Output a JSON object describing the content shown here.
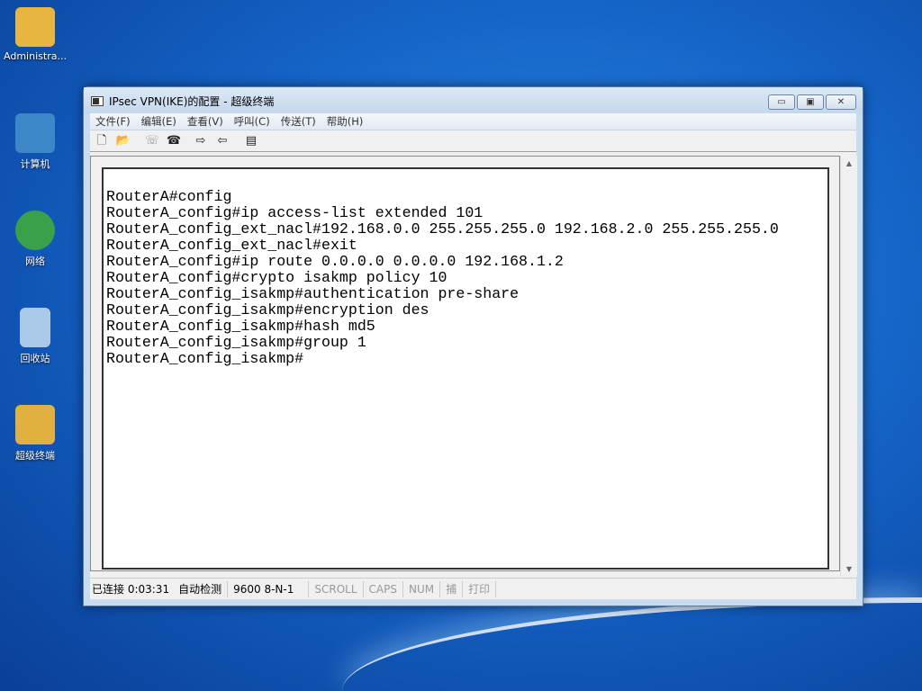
{
  "desktop": {
    "icons": [
      {
        "label": "Administra...",
        "icon": "folder-user-icon",
        "color": "#e8b640"
      },
      {
        "label": "计算机",
        "icon": "computer-icon",
        "color": "#3d86c8"
      },
      {
        "label": "网络",
        "icon": "network-icon",
        "color": "#3aa04a"
      },
      {
        "label": "回收站",
        "icon": "recycle-bin-icon",
        "color": "#aac8e8"
      },
      {
        "label": "超级终端",
        "icon": "hyperterminal-icon",
        "color": "#e0b040"
      }
    ]
  },
  "window": {
    "title": "IPsec VPN(IKE)的配置 - 超级终端",
    "minimize": "▭",
    "maximize": "▣",
    "close": "✕"
  },
  "menu": [
    "文件(F)",
    "编辑(E)",
    "查看(V)",
    "呼叫(C)",
    "传送(T)",
    "帮助(H)"
  ],
  "toolbar": [
    {
      "icon": "new-icon",
      "glyph": "🗋"
    },
    {
      "icon": "open-icon",
      "glyph": "📂"
    },
    {
      "icon": "dial-icon",
      "glyph": "☏"
    },
    {
      "icon": "disconnect-icon",
      "glyph": "☎"
    },
    {
      "icon": "send-icon",
      "glyph": "⇨"
    },
    {
      "icon": "receive-icon",
      "glyph": "⇦"
    },
    {
      "icon": "properties-icon",
      "glyph": "▤"
    }
  ],
  "terminal": {
    "lines": [
      "RouterA#config",
      "RouterA_config#ip access-list extended 101",
      "RouterA_config_ext_nacl#192.168.0.0 255.255.255.0 192.168.2.0 255.255.255.0",
      "RouterA_config_ext_nacl#exit",
      "RouterA_config#ip route 0.0.0.0 0.0.0.0 192.168.1.2",
      "RouterA_config#crypto isakmp policy 10",
      "RouterA_config_isakmp#authentication pre-share",
      "RouterA_config_isakmp#encryption des",
      "RouterA_config_isakmp#hash md5",
      "RouterA_config_isakmp#group 1",
      "RouterA_config_isakmp#"
    ]
  },
  "status": {
    "connected": "已连接 0:03:31",
    "detect": "自动检测",
    "baud": "9600 8-N-1",
    "scroll": "SCROLL",
    "caps": "CAPS",
    "num": "NUM",
    "capture": "捕",
    "print": "打印"
  }
}
